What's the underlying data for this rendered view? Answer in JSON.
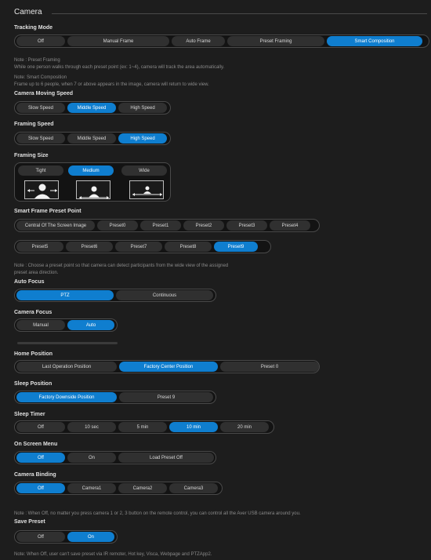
{
  "panel": {
    "title": "Camera"
  },
  "tracking_mode": {
    "label": "Tracking Mode",
    "options": [
      "Off",
      "Manual Frame",
      "Auto Frame",
      "Preset Framing",
      "Smart Composition"
    ],
    "selected": "Smart Composition"
  },
  "notes": {
    "preset_framing_title": "Note : Preset Framing",
    "preset_framing_body": "While one person walks through each preset point (ex: 1~4), camera will track the area automatically.",
    "smart_comp_title": "Note: Smart Composition",
    "smart_comp_body": "Frame up to 6 people, when 7 or above appears in the image, camera will return to wide view.",
    "preset_point_line1": "Note : Choose a preset point so that camera can detect participants from the wide view of the assigned",
    "preset_point_line2": "preset area direction.",
    "camera_binding": "Note : When Off, no matter you press camera 1 or 2, 3 button on the remote control, you can control all the Aver USB camera around you.",
    "save_preset": "Note: When Off, user can't save preset via IR remoter, Hot key, Visca, Webpage and PTZApp2."
  },
  "camera_moving_speed": {
    "label": "Camera Moving Speed",
    "options": [
      "Slow Speed",
      "Middle Speed",
      "High Speed"
    ],
    "selected": "Middle Speed"
  },
  "framing_speed": {
    "label": "Framing Speed",
    "options": [
      "Slow Speed",
      "Middle Speed",
      "High Speed"
    ],
    "selected": "High Speed"
  },
  "framing_size": {
    "label": "Framing Size",
    "options": [
      "Tight",
      "Medium",
      "Wide"
    ],
    "selected": "Medium"
  },
  "smart_frame_preset_point": {
    "label": "Smart Frame Preset Point",
    "row1": [
      "Central Of The Screen Image",
      "Preset0",
      "Preset1",
      "Preset2",
      "Preset3",
      "Preset4"
    ],
    "row2": [
      "Preset5",
      "Preset6",
      "Preset7",
      "Preset8",
      "Preset9"
    ],
    "selected": "Preset9"
  },
  "auto_focus": {
    "label": "Auto Focus",
    "options": [
      "PTZ",
      "Continuous"
    ],
    "selected": "PTZ"
  },
  "camera_focus": {
    "label": "Camera Focus",
    "options": [
      "Manual",
      "Auto"
    ],
    "selected": "Auto"
  },
  "home_position": {
    "label": "Home Position",
    "options": [
      "Last Operation Position",
      "Factory Center Position",
      "Preset 0"
    ],
    "selected": "Factory Center Position"
  },
  "sleep_position": {
    "label": "Sleep Position",
    "options": [
      "Factory Downside Position",
      "Preset 9"
    ],
    "selected": "Factory Downside Position"
  },
  "sleep_timer": {
    "label": "Sleep Timer",
    "options": [
      "Off",
      "10 sec",
      "5 min",
      "10 min",
      "20 min"
    ],
    "selected": "10 min"
  },
  "on_screen_menu": {
    "label": "On Screen Menu",
    "options": [
      "Off",
      "On",
      "Load Preset Off"
    ],
    "selected": "Off"
  },
  "camera_binding": {
    "label": "Camera Binding",
    "options": [
      "Off",
      "Camera1",
      "Camera2",
      "Camera3"
    ],
    "selected": "Off"
  },
  "save_preset": {
    "label": "Save Preset",
    "options": [
      "Off",
      "On"
    ],
    "selected": "On"
  },
  "colors": {
    "accent": "#0f7ecf",
    "background": "#1d1d1d",
    "button": "#303030"
  }
}
